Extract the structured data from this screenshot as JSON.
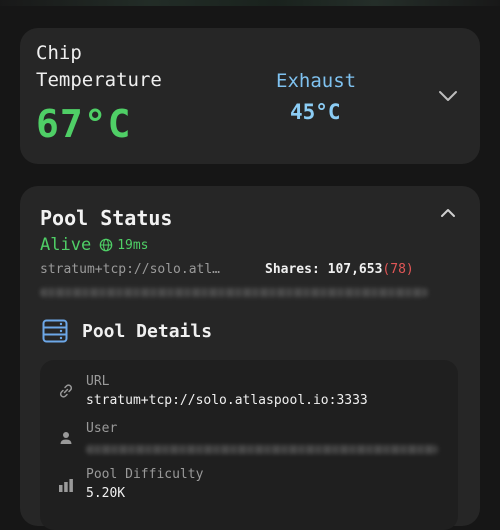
{
  "chip_temp": {
    "label": "Chip Temperature",
    "value": "67°C",
    "exhaust_label": "Exhaust",
    "exhaust_value": "45°C"
  },
  "pool_status": {
    "title": "Pool Status",
    "status": "Alive",
    "latency": "19ms",
    "url_short": "stratum+tcp://solo.atl…",
    "shares_label": "Shares:",
    "shares_value": "107,653",
    "rejected": "(78)"
  },
  "pool_details": {
    "title": "Pool Details",
    "url_label": "URL",
    "url_value": "stratum+tcp://solo.atlaspool.io:3333",
    "user_label": "User",
    "difficulty_label": "Pool Difficulty",
    "difficulty_value": "5.20K"
  },
  "colors": {
    "accent_green": "#4fcf66",
    "accent_blue": "#7fc2f0",
    "reject_red": "#e15656"
  },
  "icons": {
    "collapse_temp": "chevron-down-icon",
    "collapse_pool": "chevron-up-icon",
    "latency": "globe-icon",
    "details": "server-icon",
    "url": "link-icon",
    "user": "person-icon",
    "difficulty": "bar-chart-icon"
  }
}
